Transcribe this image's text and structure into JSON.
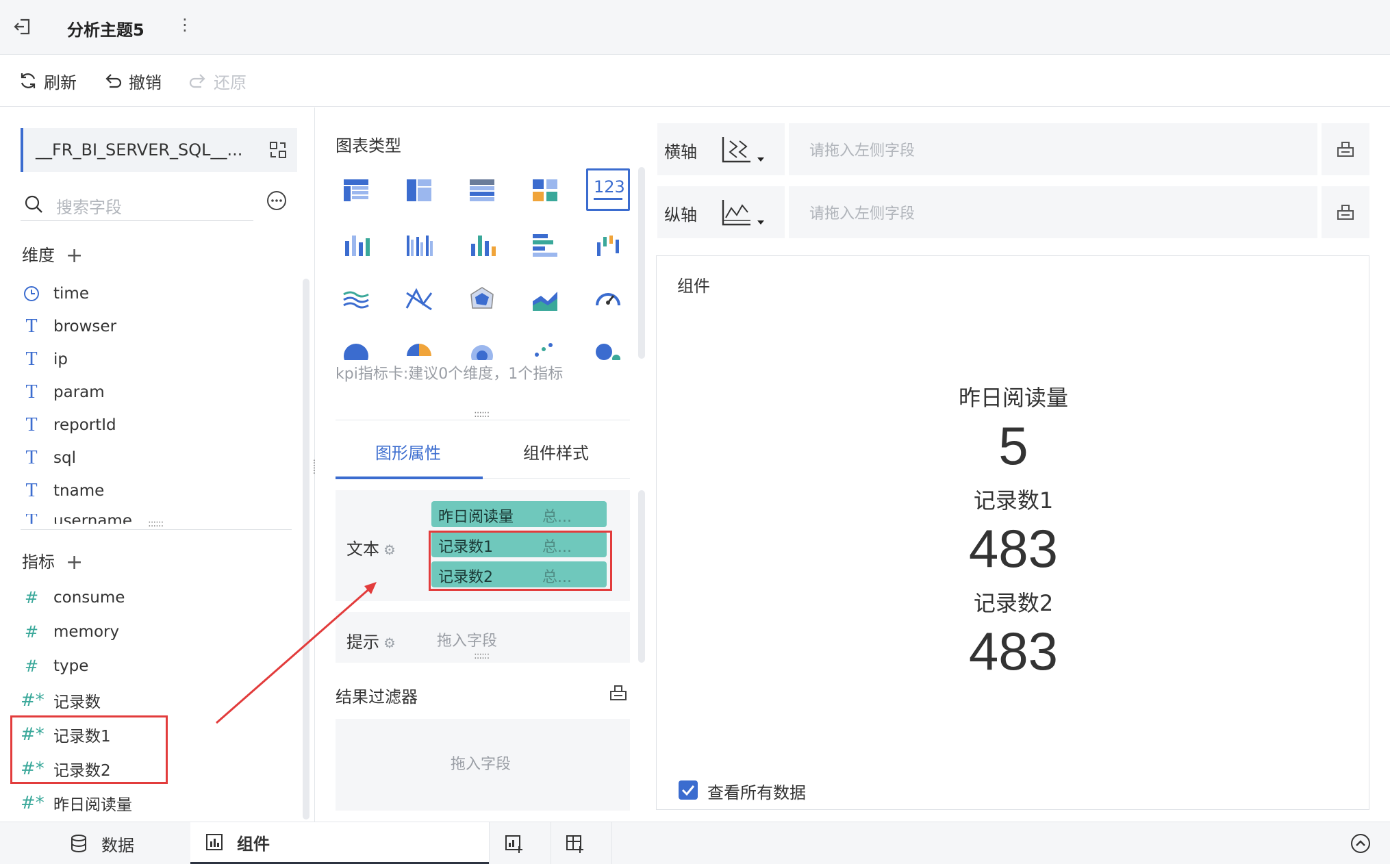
{
  "header": {
    "title": "分析主题5",
    "more": "⋮"
  },
  "toolbar": {
    "refresh": "刷新",
    "undo": "撤销",
    "redo": "还原"
  },
  "left": {
    "dataset": "__FR_BI_SERVER_SQL__...",
    "search_placeholder": "搜索字段",
    "dimensions_title": "维度",
    "dimensions": [
      "time",
      "browser",
      "ip",
      "param",
      "reportId",
      "sql",
      "tname",
      "username"
    ],
    "measures_title": "指标",
    "measures": [
      "consume",
      "memory",
      "type",
      "记录数",
      "记录数1",
      "记录数2",
      "昨日阅读量"
    ]
  },
  "mid": {
    "chart_type_title": "图表类型",
    "chart_type_desc": "kpi指标卡:建议0个维度，1个指标",
    "tabs": [
      "图形属性",
      "组件样式"
    ],
    "text_label": "文本",
    "text_fields": [
      {
        "name": "昨日阅读量",
        "agg": "总..."
      },
      {
        "name": "记录数1",
        "agg": "总..."
      },
      {
        "name": "记录数2",
        "agg": "总..."
      }
    ],
    "tip_label": "提示",
    "tip_placeholder": "拖入字段",
    "result_filter": "结果过滤器",
    "filter_placeholder": "拖入字段"
  },
  "right": {
    "x_axis": "横轴",
    "y_axis": "纵轴",
    "axis_placeholder": "请拖入左侧字段",
    "component_title": "组件",
    "kpis": [
      {
        "label": "昨日阅读量",
        "value": "5"
      },
      {
        "label": "记录数1",
        "value": "483"
      },
      {
        "label": "记录数2",
        "value": "483"
      }
    ],
    "view_all": "查看所有数据"
  },
  "bottom": {
    "data": "数据",
    "component": "组件"
  },
  "colors": {
    "accent": "#3b6ccf",
    "chip": "#6fc8bc",
    "highlight": "#e23c3c"
  }
}
